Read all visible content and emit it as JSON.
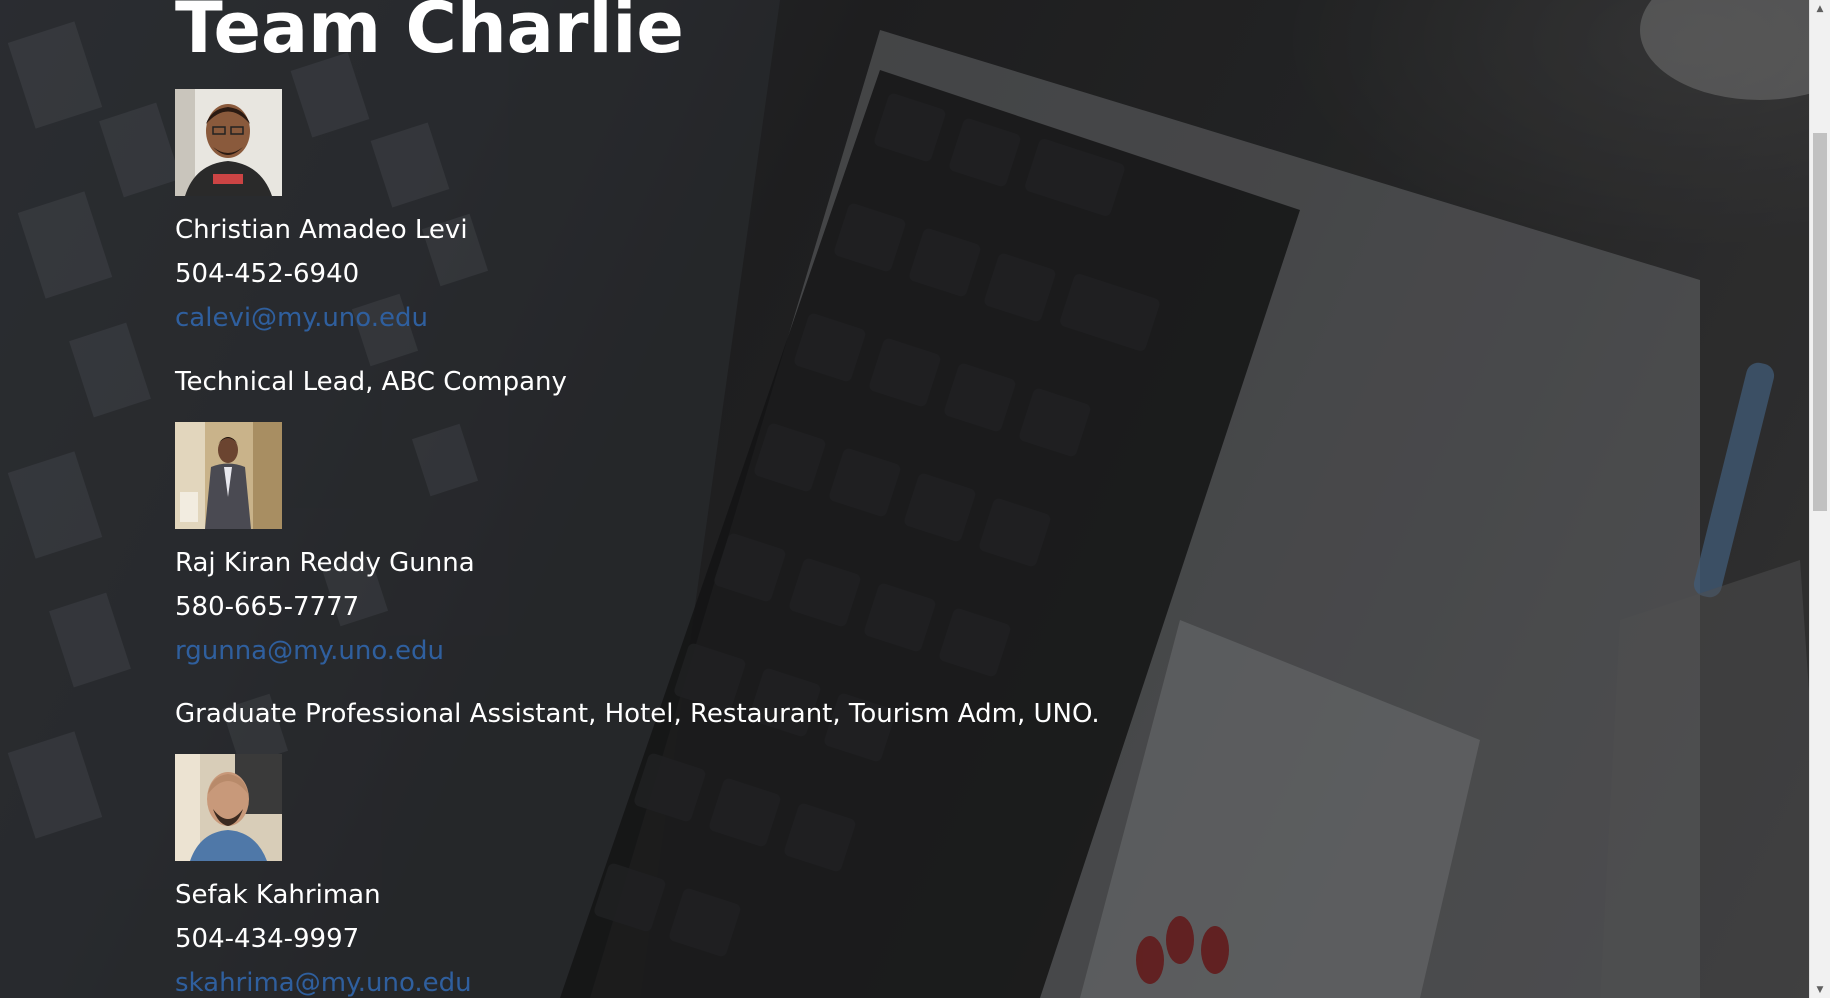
{
  "page": {
    "title": "Team Charlie"
  },
  "members": [
    {
      "name": "Christian Amadeo Levi",
      "phone": "504-452-6940",
      "email": "calevi@my.uno.edu",
      "role": "Technical Lead, ABC Company",
      "photo_icon": "person-photo"
    },
    {
      "name": "Raj Kiran Reddy Gunna",
      "phone": "580-665-7777",
      "email": "rgunna@my.uno.edu",
      "role": "Graduate Professional Assistant, Hotel, Restaurant, Tourism Adm, UNO.",
      "photo_icon": "person-photo"
    },
    {
      "name": "Sefak Kahriman",
      "phone": "504-434-9997",
      "email": "skahrima@my.uno.edu",
      "photo_icon": "person-photo"
    }
  ],
  "colors": {
    "text": "#ffffff",
    "link": "#2f5f9e",
    "scrollbar_track": "#f1f1f1",
    "scrollbar_thumb": "#c1c1c1"
  },
  "scrollbar": {
    "up_icon": "triangle-up-icon",
    "down_icon": "triangle-down-icon"
  }
}
